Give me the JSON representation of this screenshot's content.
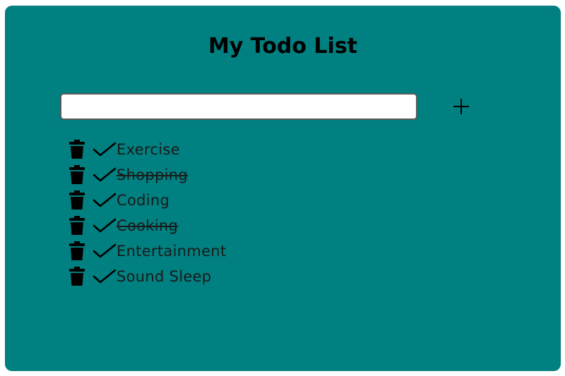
{
  "app": {
    "title": "My Todo List",
    "colors": {
      "card_background": "#008080",
      "page_background": "#ffffff",
      "text": "#000000"
    }
  },
  "input": {
    "value": "",
    "placeholder": ""
  },
  "add_button": {
    "icon": "plus-icon"
  },
  "todos": [
    {
      "label": "Exercise",
      "completed": false
    },
    {
      "label": "Shopping",
      "completed": true
    },
    {
      "label": "Coding",
      "completed": false
    },
    {
      "label": "Cooking",
      "completed": true
    },
    {
      "label": "Entertainment",
      "completed": false
    },
    {
      "label": "Sound Sleep",
      "completed": false
    }
  ],
  "item_icons": {
    "delete": "trash-icon",
    "complete": "check-icon"
  }
}
